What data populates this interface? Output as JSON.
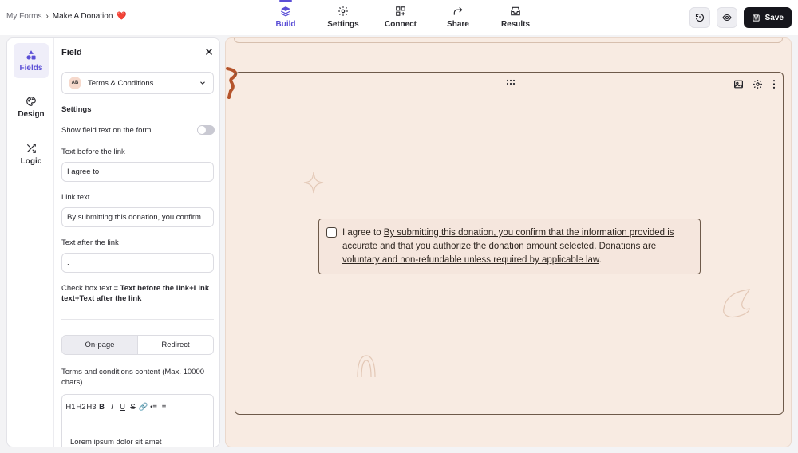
{
  "breadcrumb": {
    "root": "My Forms",
    "separator": "›",
    "current": "Make A Donation",
    "current_emoji": "❤️"
  },
  "nav": {
    "tabs": [
      {
        "label": "Build",
        "icon": "layers-icon",
        "active": true
      },
      {
        "label": "Settings",
        "icon": "gear-icon",
        "active": false
      },
      {
        "label": "Connect",
        "icon": "grid-plus-icon",
        "active": false
      },
      {
        "label": "Share",
        "icon": "share-arrow-icon",
        "active": false
      },
      {
        "label": "Results",
        "icon": "inbox-icon",
        "active": false
      }
    ]
  },
  "actions": {
    "history_icon": "history-icon",
    "preview_icon": "eye-icon",
    "save_label": "Save"
  },
  "rail": {
    "items": [
      {
        "label": "Fields",
        "icon": "shapes-icon",
        "active": true
      },
      {
        "label": "Design",
        "icon": "palette-icon",
        "active": false
      },
      {
        "label": "Logic",
        "icon": "shuffle-icon",
        "active": false
      }
    ]
  },
  "field_panel": {
    "title": "Field",
    "field_type": "Terms & Conditions",
    "field_badge": "AB",
    "settings_heading": "Settings",
    "show_text_label": "Show field text on the form",
    "show_text_enabled": false,
    "text_before_label": "Text before the link",
    "text_before_value": "I agree to",
    "link_text_label": "Link text",
    "link_text_value": "By submitting this donation, you confirm",
    "text_after_label": "Text after the link",
    "text_after_value": ".",
    "hint_prefix": "Check box text = ",
    "hint_formula": "Text before the link+Link text+Text after the link",
    "mode_options": [
      "On-page",
      "Redirect"
    ],
    "mode_selected": "On-page",
    "content_label": "Terms and conditions content (Max. 10000 chars)",
    "editor_tools": [
      "H1",
      "H2",
      "H3",
      "B",
      "I",
      "U",
      "S",
      "🔗",
      "•≡",
      "≡"
    ],
    "editor_preview": "Lorem ipsum dolor sit amet"
  },
  "canvas": {
    "checkbox_before": "I agree to ",
    "checkbox_link": "By submitting this donation, you confirm that the information provided is accurate and that you authorize the donation amount selected. Donations are voluntary and non-refundable unless required by applicable law",
    "checkbox_after": ".",
    "colors": {
      "background": "#f8ebe2",
      "card_border": "#6e5a4a",
      "accent": "#5b4fd6"
    }
  }
}
